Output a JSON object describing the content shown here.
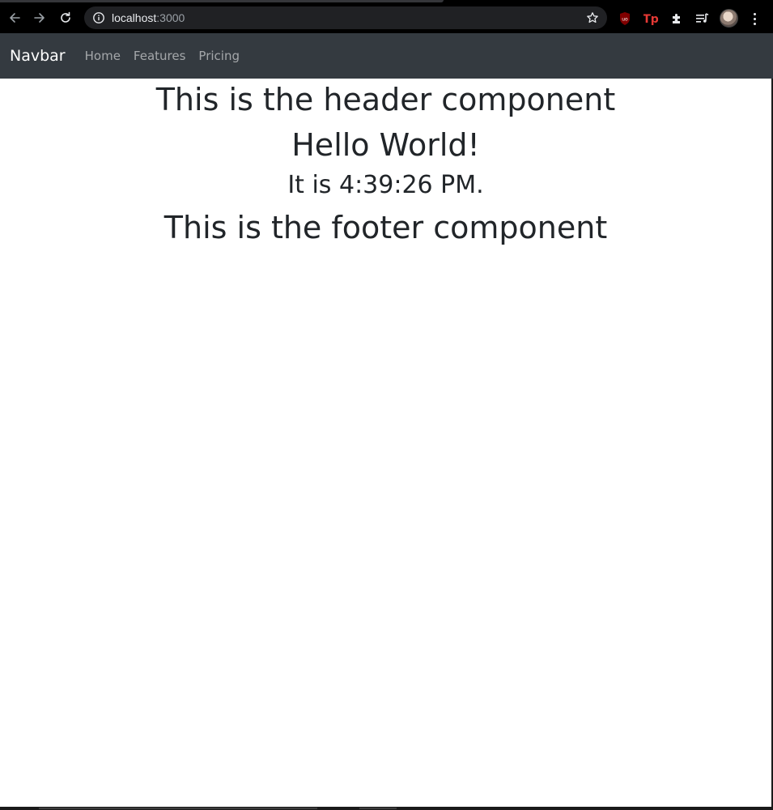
{
  "browser": {
    "url_host": "localhost",
    "url_port": ":3000",
    "icons": {
      "back": "back-arrow-icon",
      "forward": "forward-arrow-icon",
      "reload": "reload-icon",
      "site_info": "info-icon",
      "bookmark": "star-icon",
      "ublock": "ublock-shield-icon",
      "tp": "tp-extension-icon",
      "extensions": "puzzle-piece-icon",
      "media": "media-queue-icon",
      "profile": "avatar",
      "menu": "kebab-menu-icon"
    },
    "colors": {
      "toolbar_bg": "#000000",
      "omnibox_bg": "#202124",
      "text": "#e8eaed",
      "muted": "#9aa0a6",
      "ublock_red": "#800000",
      "tp_red": "#e53935"
    }
  },
  "navbar": {
    "brand": "Navbar",
    "links": [
      {
        "label": "Home"
      },
      {
        "label": "Features"
      },
      {
        "label": "Pricing"
      }
    ],
    "colors": {
      "bg": "#343a40",
      "brand": "#ffffff",
      "link": "rgba(255,255,255,0.55)"
    }
  },
  "main": {
    "header_text": "This is the header component",
    "hello_text": "Hello World!",
    "time_text": "It is 4:39:26 PM.",
    "footer_text": "This is the footer component",
    "colors": {
      "text": "#212529",
      "bg": "#ffffff"
    }
  }
}
